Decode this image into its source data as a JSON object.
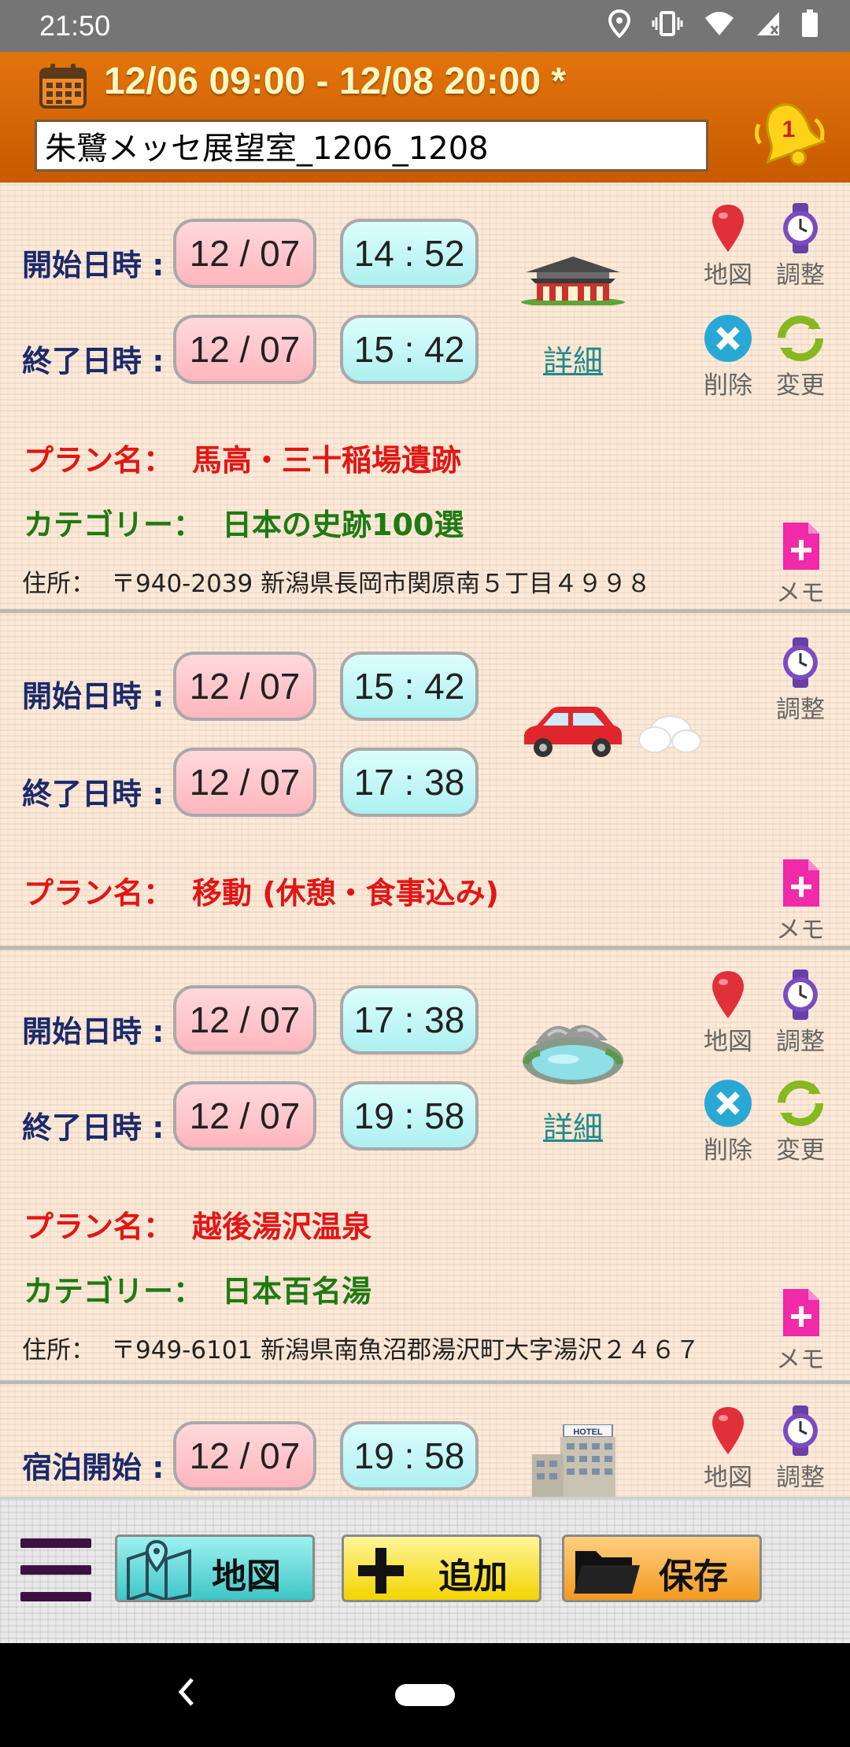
{
  "status_bar": {
    "time": "21:50",
    "icons": [
      "location-icon",
      "vibrate-icon",
      "wifi-icon",
      "signal-icon",
      "battery-icon"
    ]
  },
  "header": {
    "date_range": "12/06 09:00 - 12/08 20:00 *",
    "trip_name": "朱鷺メッセ展望室_1206_1208",
    "alarm_count": "1"
  },
  "labels": {
    "start": "開始日時 :",
    "end": "終了日時 :",
    "stay_start": "宿泊開始 :",
    "detail": "詳細",
    "plan_name": "プラン名：",
    "category": "カテゴリー：",
    "address": "住所：",
    "map": "地図",
    "adjust": "調整",
    "delete": "削除",
    "change": "変更",
    "memo": "メモ"
  },
  "items": [
    {
      "start_date": "12 / 07",
      "start_time": "14 : 52",
      "end_date": "12 / 07",
      "end_time": "15 : 42",
      "plan": "馬高・三十稲場遺跡",
      "category": "日本の史跡100選",
      "address": "〒940-2039 新潟県長岡市関原南５丁目４９９８",
      "illustration": "temple-icon"
    },
    {
      "start_date": "12 / 07",
      "start_time": "15 : 42",
      "end_date": "12 / 07",
      "end_time": "17 : 38",
      "plan": "移動 (休憩・食事込み)",
      "illustration": "car-icon"
    },
    {
      "start_date": "12 / 07",
      "start_time": "17 : 38",
      "end_date": "12 / 07",
      "end_time": "19 : 58",
      "plan": "越後湯沢温泉",
      "category": "日本百名湯",
      "address": "〒949-6101 新潟県南魚沼郡湯沢町大字湯沢２４６７",
      "illustration": "hot-spring-icon"
    },
    {
      "start_date": "12 / 07",
      "start_time": "19 : 58",
      "illustration": "hotel-icon",
      "hotel_sign": "HOTEL"
    }
  ],
  "toolbar": {
    "map_label": "地図",
    "add_label": "追加",
    "save_label": "保存"
  },
  "colors": {
    "header": "#d96808",
    "date_range_text": "#fff8c0",
    "label_text": "#1c2a6b",
    "plan_text": "#e31515",
    "category_text": "#1f7a14",
    "date_pill": "#ffc4c9",
    "time_pill": "#bff5f5"
  }
}
